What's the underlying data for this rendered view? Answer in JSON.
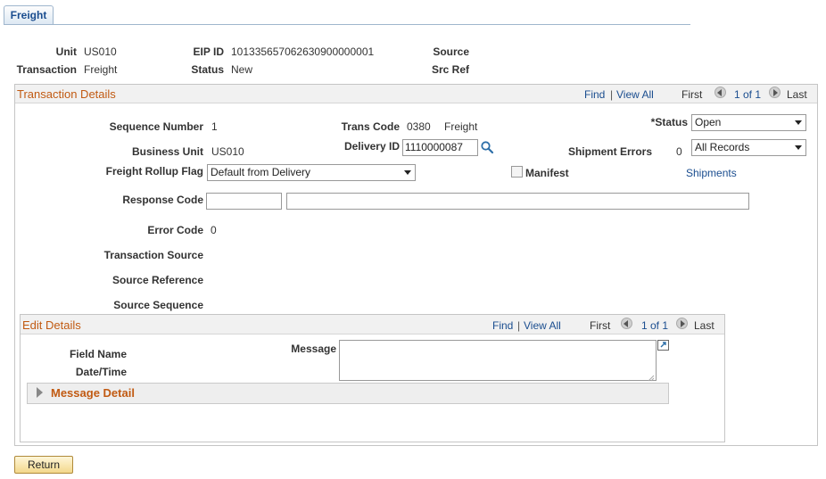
{
  "tab": {
    "label": "Freight"
  },
  "header": {
    "unit_label": "Unit",
    "unit_value": "US010",
    "eip_label": "EIP ID",
    "eip_value": "101335657062630900000001",
    "source_label": "Source",
    "transaction_label": "Transaction",
    "transaction_value": "Freight",
    "status_label": "Status",
    "status_value": "New",
    "srcref_label": "Src Ref"
  },
  "transaction_details": {
    "title": "Transaction Details",
    "nav": {
      "find": "Find",
      "sep": "|",
      "view_all": "View All",
      "first": "First",
      "count": "1 of 1",
      "last": "Last"
    },
    "sequence_label": "Sequence Number",
    "sequence_value": "1",
    "trans_code_label": "Trans Code",
    "trans_code_value": "0380",
    "trans_code_desc": "Freight",
    "status_label": "*Status",
    "status_value": "Open",
    "business_unit_label": "Business Unit",
    "business_unit_value": "US010",
    "delivery_label": "Delivery ID",
    "delivery_value": "1110000087",
    "shipment_errors_label": "Shipment Errors",
    "shipment_errors_value": "0",
    "shipment_errors_select": "All Records",
    "freight_rollup_label": "Freight Rollup Flag",
    "freight_rollup_value": "Default from Delivery",
    "manifest_label": "Manifest",
    "shipments_link": "Shipments",
    "response_code_label": "Response Code",
    "response_code_value": "",
    "response_desc_value": "",
    "error_code_label": "Error Code",
    "error_code_value": "0",
    "transaction_source_label": "Transaction Source",
    "source_reference_label": "Source Reference",
    "source_sequence_label": "Source Sequence"
  },
  "edit_details": {
    "title": "Edit Details",
    "nav": {
      "find": "Find",
      "sep": "|",
      "view_all": "View All",
      "first": "First",
      "count": "1 of 1",
      "last": "Last"
    },
    "field_name_label": "Field Name",
    "datetime_label": "Date/Time",
    "message_label": "Message",
    "message_value": "",
    "message_detail_label": "Message Detail"
  },
  "footer": {
    "return_label": "Return"
  }
}
